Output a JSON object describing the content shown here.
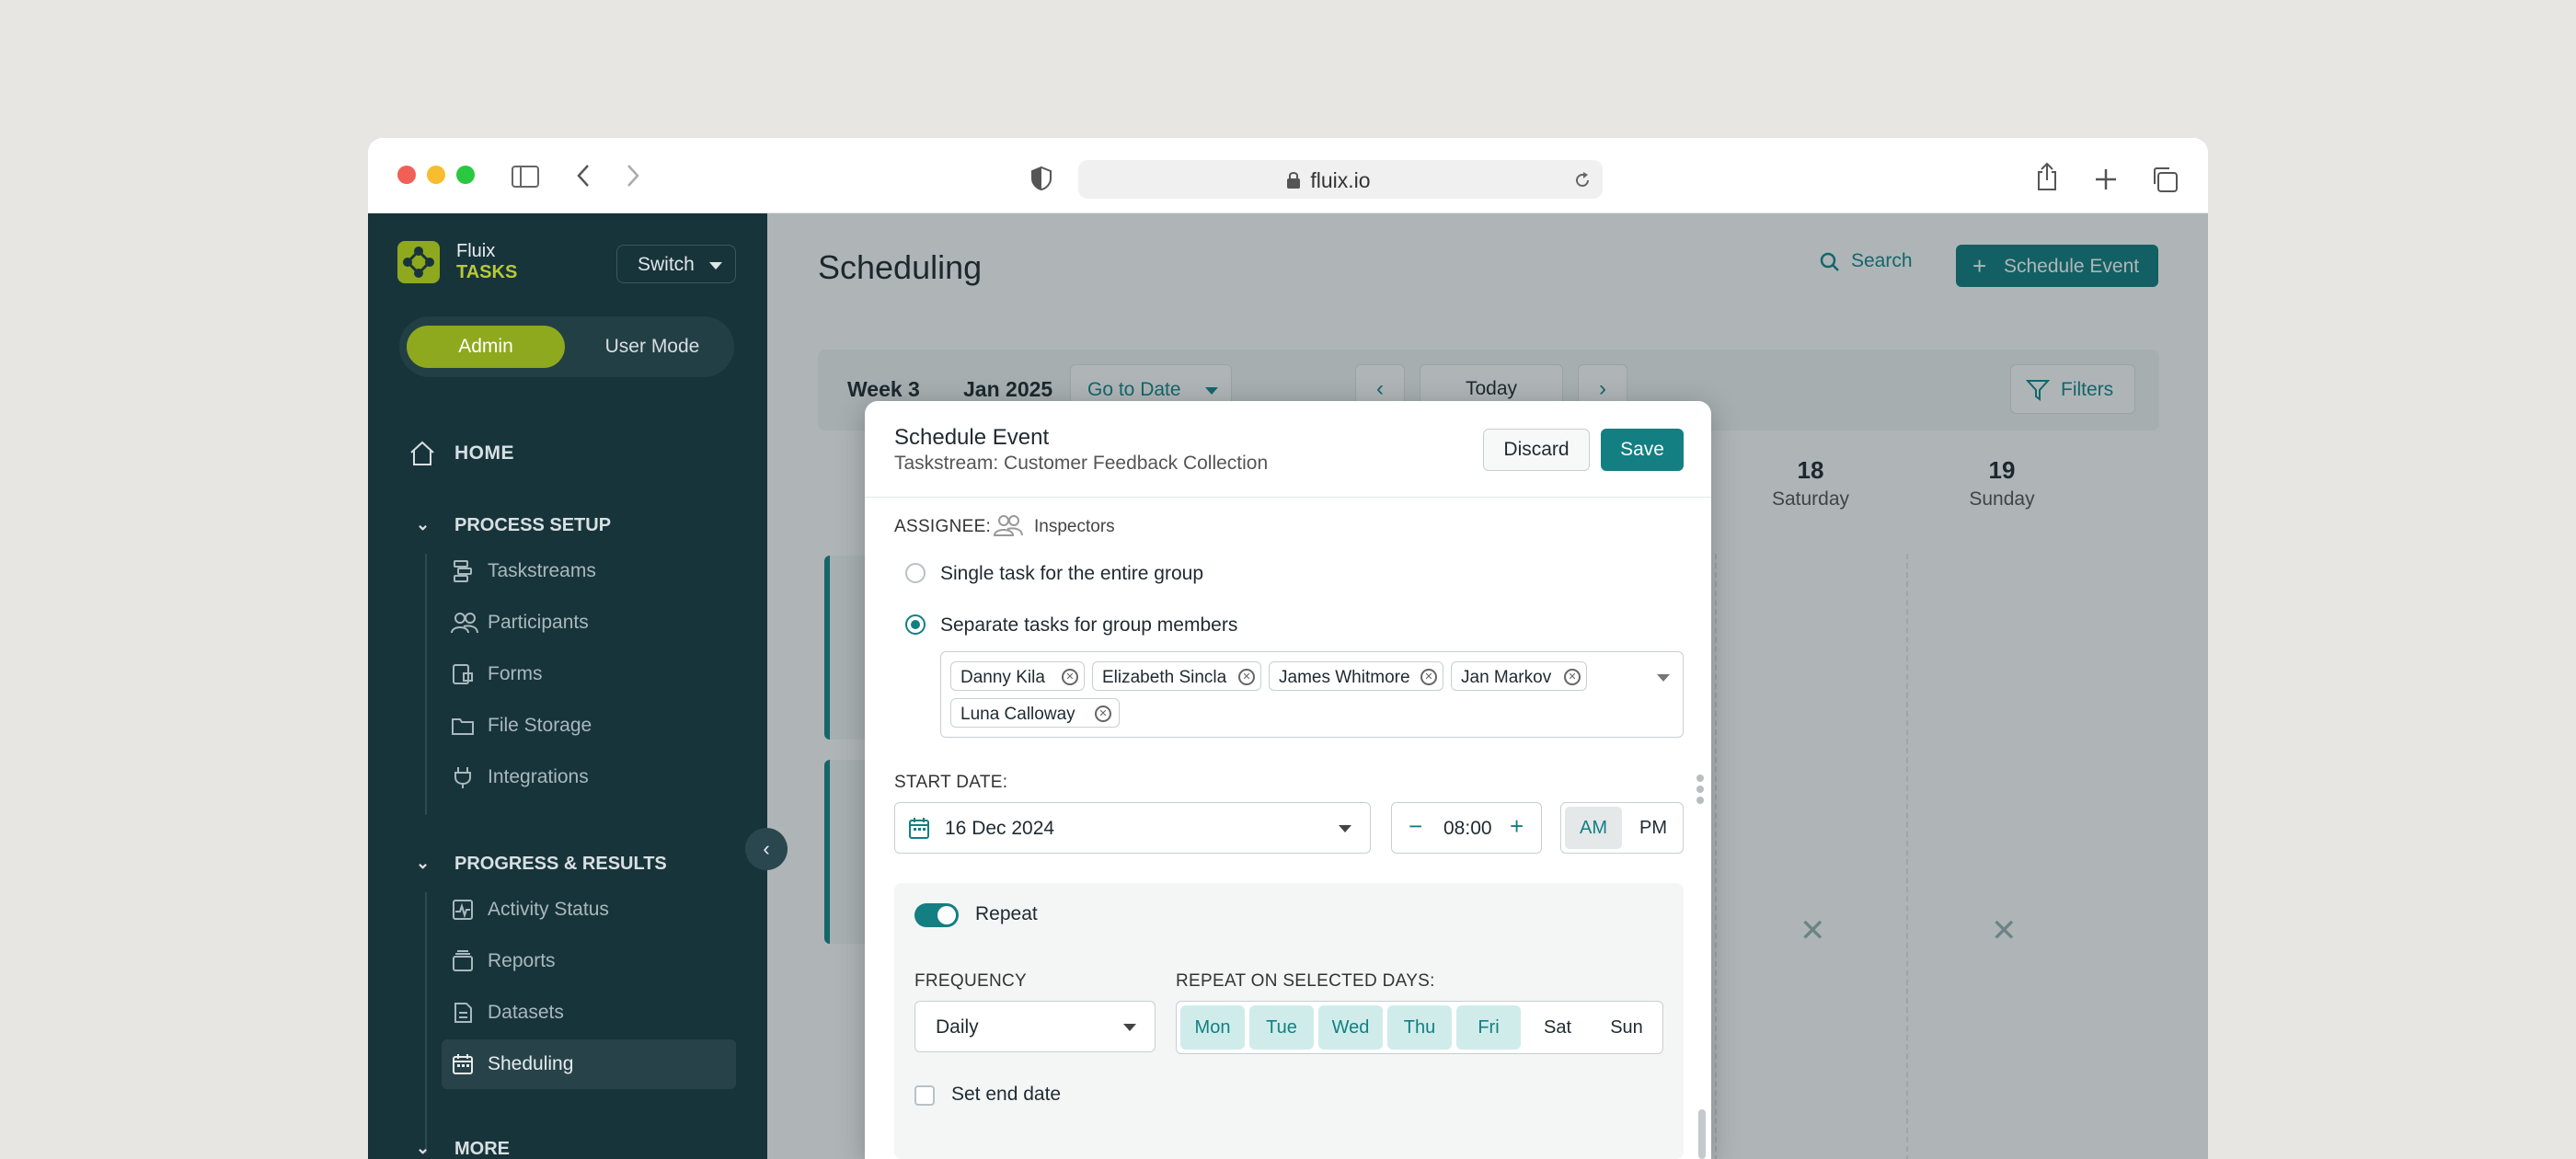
{
  "browser": {
    "url": "fluix.io"
  },
  "sidebar": {
    "brand_line1": "Fluix",
    "brand_line2": "TASKS",
    "switch_label": "Switch",
    "mode_admin": "Admin",
    "mode_user": "User Mode",
    "home": "HOME",
    "section_process": "PROCESS SETUP",
    "process_items": [
      "Taskstreams",
      "Participants",
      "Forms",
      "File Storage",
      "Integrations"
    ],
    "section_progress": "PROGRESS & RESULTS",
    "progress_items": [
      "Activity Status",
      "Reports",
      "Datasets",
      "Sheduling"
    ],
    "section_more": "MORE"
  },
  "main": {
    "title": "Scheduling",
    "search_label": "Search",
    "schedule_label": "Schedule Event",
    "week": "Week 3",
    "month": "Jan 2025",
    "go_to_date": "Go to Date",
    "today": "Today",
    "filters": "Filters",
    "days": [
      {
        "num": "18",
        "name": "Saturday"
      },
      {
        "num": "19",
        "name": "Sunday"
      }
    ]
  },
  "modal": {
    "title": "Schedule Event",
    "subtitle": "Taskstream: Customer Feedback Collection",
    "discard": "Discard",
    "save": "Save",
    "assignee_label": "ASSIGNEE:",
    "assignee_value": "Inspectors",
    "option_single": "Single task for the entire group",
    "option_separate": "Separate tasks for group members",
    "members": [
      "Danny Kila",
      "Elizabeth Sincla",
      "James Whitmore",
      "Jan Markov",
      "Luna Calloway"
    ],
    "start_date_label": "START DATE:",
    "start_date": "16 Dec 2024",
    "time": "08:00",
    "am": "AM",
    "pm": "PM",
    "repeat_label": "Repeat",
    "frequency_label": "FREQUENCY",
    "frequency_value": "Daily",
    "repeat_days_label": "REPEAT ON SELECTED DAYS:",
    "weekdays": [
      "Mon",
      "Tue",
      "Wed",
      "Thu",
      "Fri",
      "Sat",
      "Sun"
    ],
    "end_date_label": "Set end date"
  }
}
